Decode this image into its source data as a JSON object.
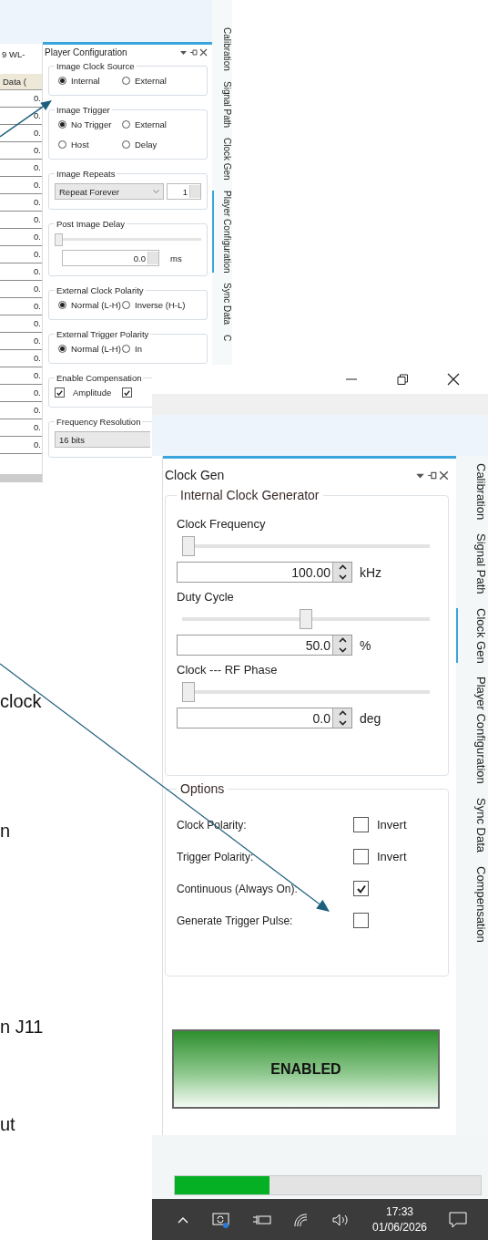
{
  "document_fragments": [
    "clock",
    "n",
    "n J11",
    "ut"
  ],
  "player_configuration_window": {
    "table": {
      "column_1": "9 WL-",
      "column_2": "Data (",
      "cells": [
        "0.",
        "0.",
        "0.",
        "0.",
        "0.",
        "0.",
        "0.",
        "0.",
        "0.",
        "0.",
        "0.",
        "0.",
        "0.",
        "0.",
        "0.",
        "0.",
        "0.",
        "0.",
        "0.",
        "0.",
        "0."
      ]
    },
    "panel_title": "Player Configuration",
    "groups": [
      {
        "kind": "radios",
        "title": "Image Clock Source",
        "options": [
          {
            "label": "Internal",
            "selected": true
          },
          {
            "label": "External",
            "selected": false
          }
        ]
      },
      {
        "kind": "radios",
        "title": "Image Trigger",
        "options": [
          {
            "label": "No Trigger",
            "selected": true
          },
          {
            "label": "External",
            "selected": false
          },
          {
            "label": "Host",
            "selected": false
          },
          {
            "label": "Delay",
            "selected": false
          }
        ]
      },
      {
        "kind": "repeats",
        "title": "Image Repeats",
        "dropdown": "Repeat Forever",
        "spin_value": "1"
      },
      {
        "kind": "slider",
        "title": "Post Image Delay",
        "level": 0,
        "value": "0.0",
        "unit": "ms"
      },
      {
        "kind": "radios",
        "title": "External Clock Polarity",
        "options": [
          {
            "label": "Normal (L-H)",
            "selected": true
          },
          {
            "label": "Inverse (H-L)",
            "selected": false
          }
        ]
      },
      {
        "kind": "radios",
        "title": "External Trigger Polarity",
        "options": [
          {
            "label": "Normal (L-H)",
            "selected": true
          },
          {
            "label": "In",
            "selected": false
          }
        ]
      },
      {
        "kind": "checks",
        "title": "Enable Compensation",
        "options": [
          {
            "label": "Amplitude",
            "checked": true
          },
          {
            "checked": true
          }
        ]
      },
      {
        "kind": "dropdown",
        "title": "Frequency Resolution",
        "value": "16 bits"
      }
    ],
    "side_tabs": [
      {
        "label": "Calibration",
        "selected": false
      },
      {
        "label": "Signal Path",
        "selected": false
      },
      {
        "label": "Clock Gen",
        "selected": false
      },
      {
        "label": "Player Configuration",
        "selected": true
      },
      {
        "label": "Sync Data",
        "selected": false
      },
      {
        "label": "C",
        "selected": false
      }
    ]
  },
  "clock_gen_window": {
    "panel_title": "Clock Gen",
    "generator": {
      "title": "Internal Clock Generator",
      "controls": [
        {
          "label": "Clock Frequency",
          "level": 0,
          "value": "100.00",
          "unit": "kHz"
        },
        {
          "label": "Duty Cycle",
          "level": 0.5,
          "value": "50.0",
          "unit": "%"
        },
        {
          "label": "Clock --- RF Phase",
          "level": 0,
          "value": "0.0",
          "unit": "deg"
        }
      ]
    },
    "options": {
      "title": "Options",
      "rows": [
        {
          "label": "Clock Polarity:",
          "checked": false,
          "caption": "Invert"
        },
        {
          "label": "Trigger Polarity:",
          "checked": false,
          "caption": "Invert"
        },
        {
          "label": "Continuous (Always On):",
          "checked": true
        },
        {
          "label": "Generate Trigger Pulse:",
          "checked": false
        }
      ]
    },
    "enable_button": "ENABLED",
    "side_tabs": [
      {
        "label": "Calibration",
        "selected": false
      },
      {
        "label": "Signal Path",
        "selected": false
      },
      {
        "label": "Clock Gen",
        "selected": true
      },
      {
        "label": "Player Configuration",
        "selected": false
      },
      {
        "label": "Sync Data",
        "selected": false
      },
      {
        "label": "Compensation",
        "selected": false
      }
    ],
    "progress": {
      "level": 0.31
    },
    "taskbar": {
      "time": "17:33",
      "date": "01/06/2026"
    }
  }
}
